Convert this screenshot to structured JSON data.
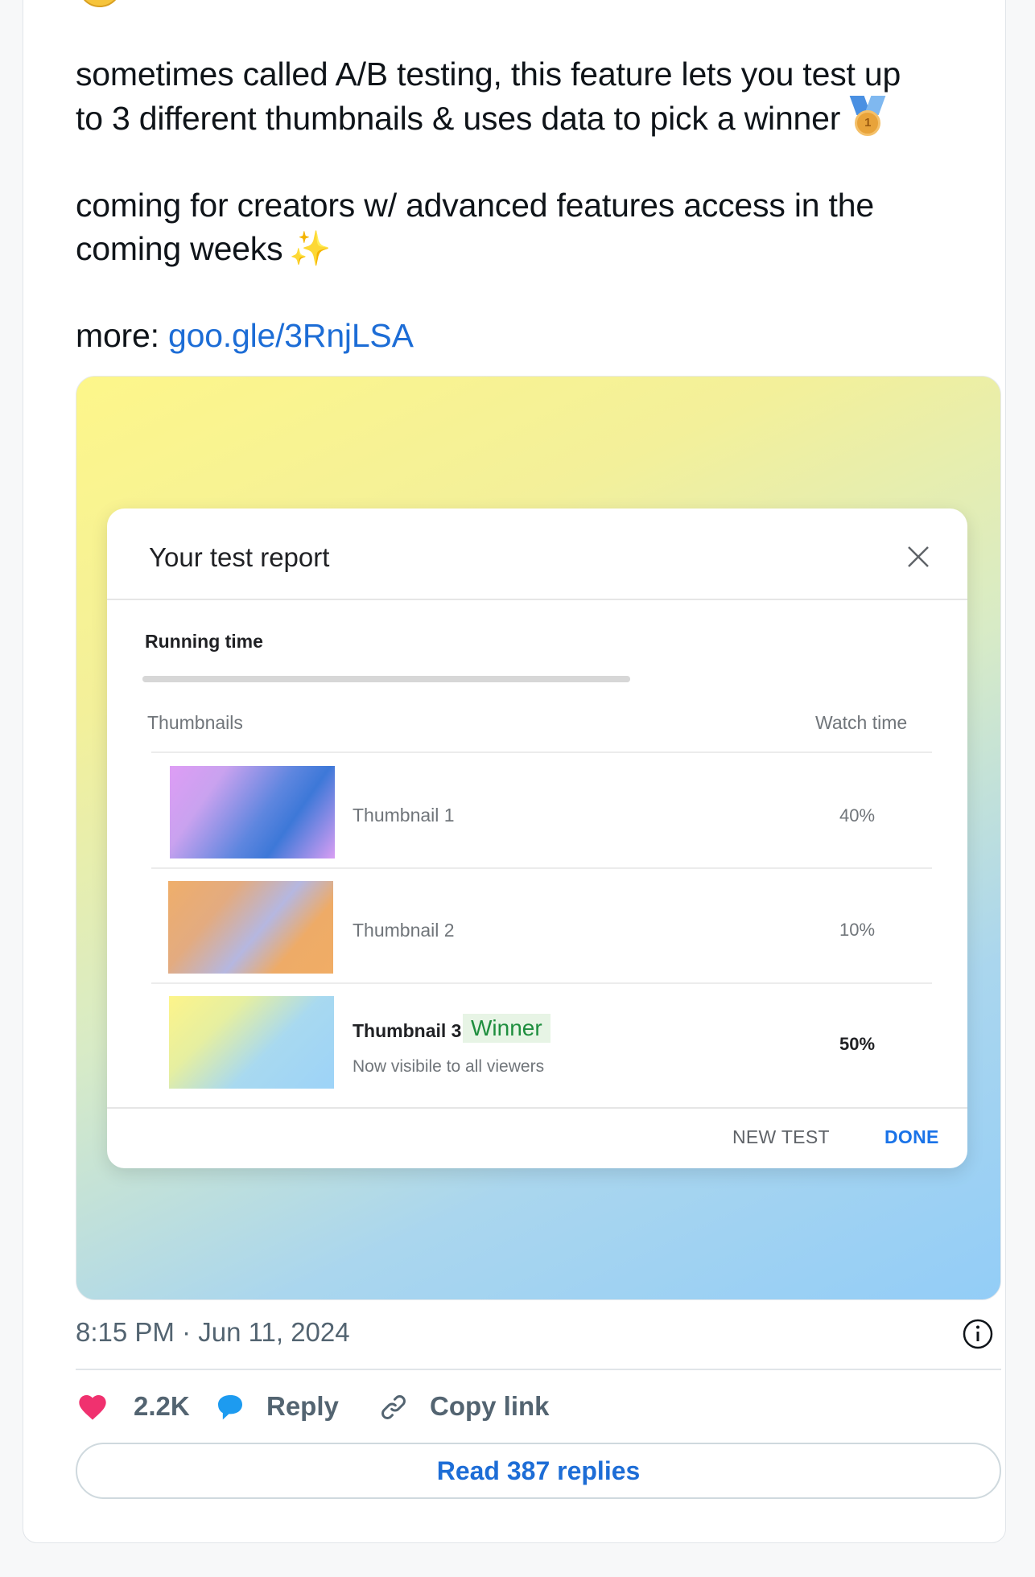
{
  "tweet": {
    "line1": "sometimes called A/B testing, this feature lets you test up",
    "line2": "to 3 different thumbnails & uses data to pick a winner",
    "line3": "coming for creators w/ advanced features access in the",
    "line4": "coming weeks",
    "more_prefix": "more: ",
    "link": "goo.gle/3RnjLSA",
    "medal_number": "1",
    "emoji_medal": "medal-icon",
    "emoji_sparkles": "sparkles-icon",
    "emoji_top": "grinning-face-icon"
  },
  "report": {
    "title": "Your test report",
    "running_time_label": "Running time",
    "running_progress": 1.0,
    "col_thumbnails": "Thumbnails",
    "col_watch_time": "Watch time",
    "rows": [
      {
        "name": "Thumbnail 1",
        "watch_time": "40%"
      },
      {
        "name": "Thumbnail 2",
        "watch_time": "10%"
      },
      {
        "name": "Thumbnail 3",
        "watch_time": "50%",
        "badge": "Winner",
        "note": "Now visibile to all viewers"
      }
    ],
    "new_test": "NEW TEST",
    "done": "DONE"
  },
  "meta": {
    "timestamp": "8:15 PM · Jun 11, 2024",
    "likes": "2.2K",
    "reply": "Reply",
    "copy_link": "Copy link",
    "read_replies": "Read 387 replies"
  },
  "colors": {
    "link": "#1d6dd6",
    "like": "#f0316f",
    "reply_icon": "#1d9bf0",
    "winner_green": "#1e8e3e",
    "done_blue": "#1a73e8"
  }
}
